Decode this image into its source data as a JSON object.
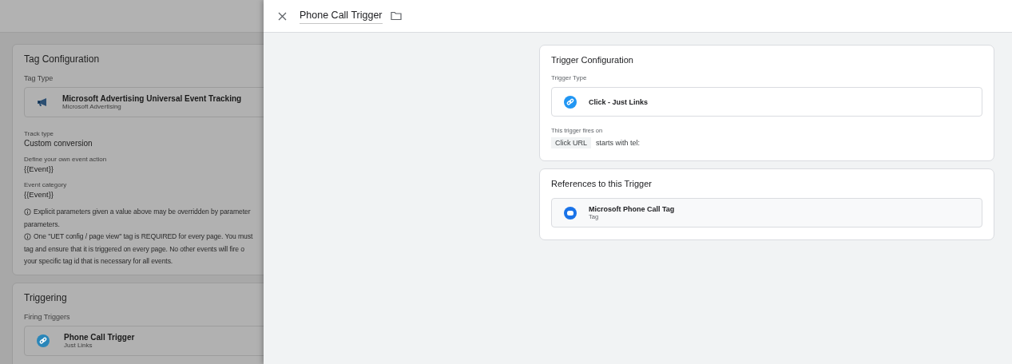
{
  "background_page": {
    "tag_configuration": {
      "title": "Tag Configuration",
      "tag_type_label": "Tag Type",
      "tag_type": {
        "name": "Microsoft Advertising Universal Event Tracking",
        "vendor": "Microsoft Advertising"
      },
      "fields": [
        {
          "label": "Track type",
          "value": "Custom conversion",
          "kind": "large"
        },
        {
          "label": "Define your own event action",
          "value": "{{Event}}",
          "kind": "small"
        },
        {
          "label": "Event category",
          "value": "{{Event}}",
          "kind": "small"
        }
      ],
      "notes": [
        {
          "lines": [
            "Explicit parameters given a value above may be overridden by parameter",
            "parameters."
          ]
        },
        {
          "lines": [
            "One \"UET config / page view\" tag is REQUIRED for every page. You must",
            "tag and ensure that it is triggered on every page. No other events will fire o",
            "your specific tag id that is necessary for all events."
          ]
        }
      ]
    },
    "triggering": {
      "title": "Triggering",
      "label": "Firing Triggers",
      "trigger": {
        "name": "Phone Call Trigger",
        "type": "Just Links"
      }
    }
  },
  "panel": {
    "title": "Phone Call Trigger",
    "trigger_configuration": {
      "title": "Trigger Configuration",
      "type_label": "Trigger Type",
      "type": "Click - Just Links",
      "fires_on_label": "This trigger fires on",
      "condition": {
        "variable": "Click URL",
        "rule": "starts with tel:"
      }
    },
    "references": {
      "title": "References to this Trigger",
      "items": [
        {
          "name": "Microsoft Phone Call Tag",
          "kind": "Tag"
        }
      ]
    }
  }
}
